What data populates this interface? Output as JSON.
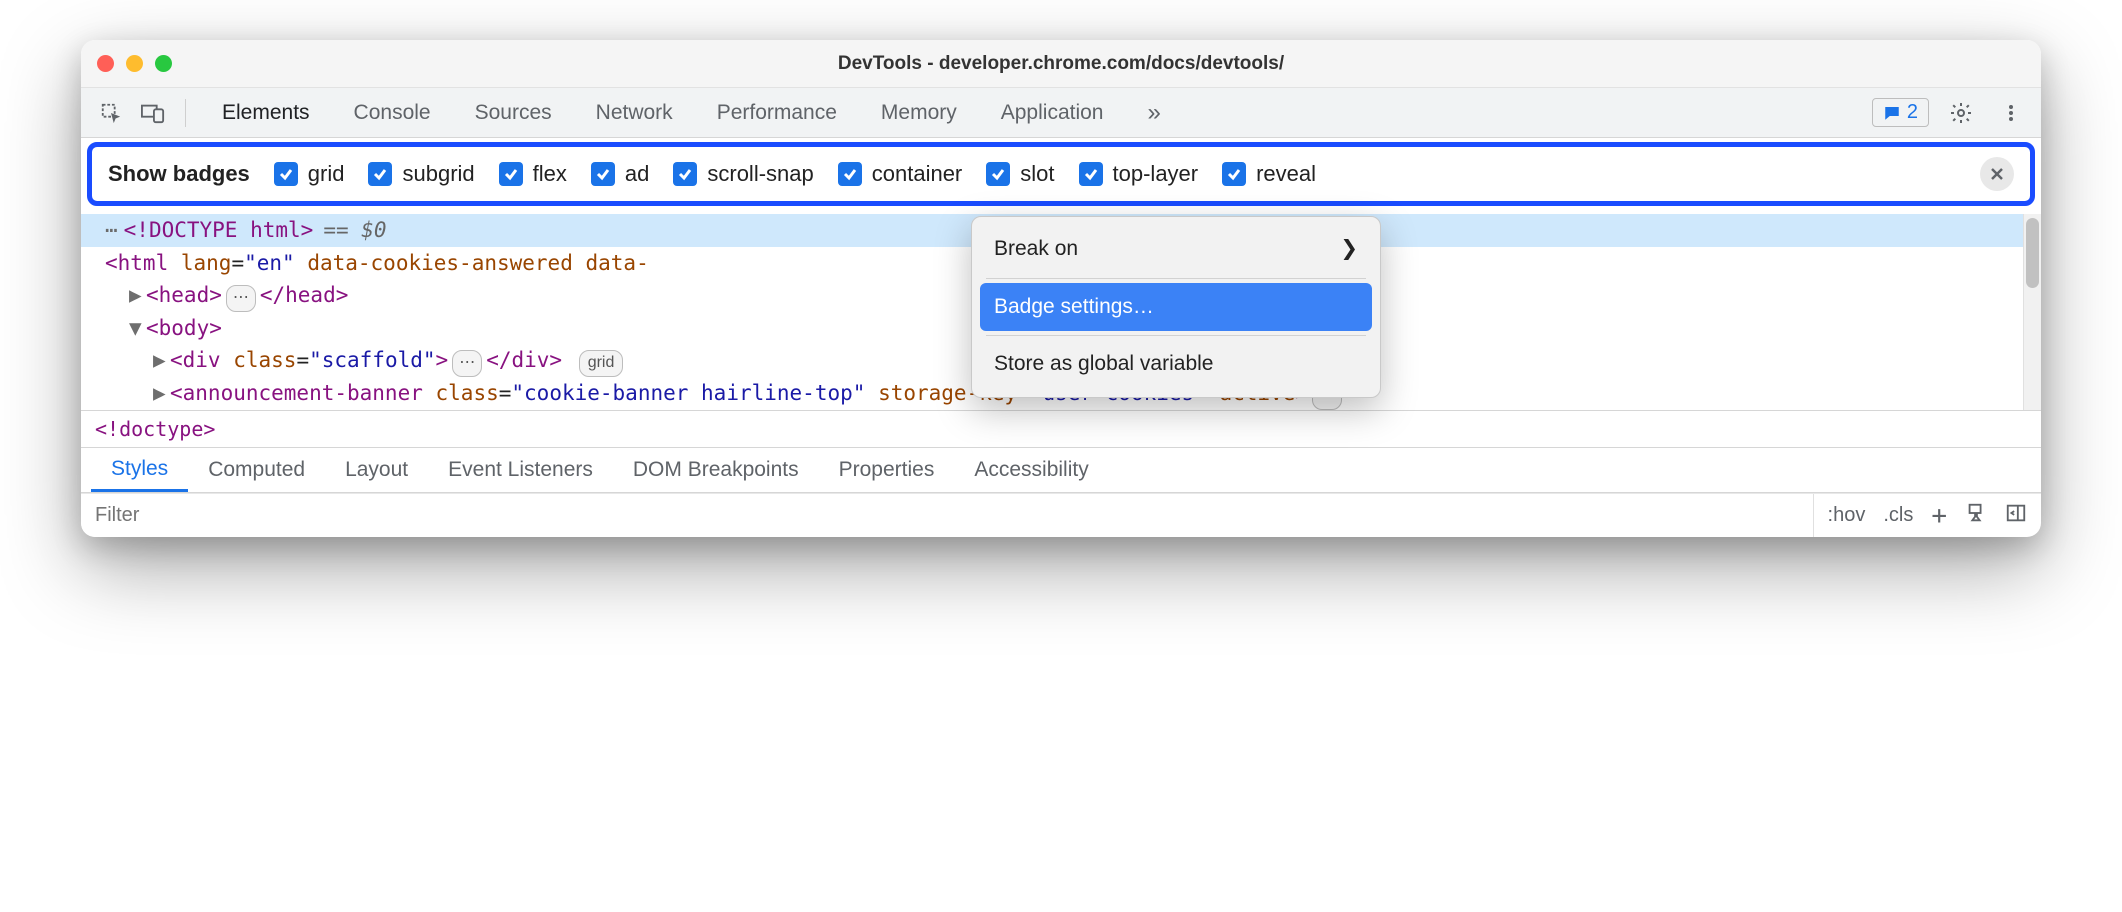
{
  "window": {
    "title": "DevTools - developer.chrome.com/docs/devtools/"
  },
  "toolbar": {
    "tabs": [
      "Elements",
      "Console",
      "Sources",
      "Network",
      "Performance",
      "Memory",
      "Application"
    ],
    "active_tab": "Elements",
    "overflow_symbol": "»",
    "issues_count": "2"
  },
  "badges_bar": {
    "label": "Show badges",
    "items": [
      "grid",
      "subgrid",
      "flex",
      "ad",
      "scroll-snap",
      "container",
      "slot",
      "top-layer",
      "reveal"
    ]
  },
  "dom": {
    "line1_text": "<!DOCTYPE html>",
    "line1_suffix": "== $0",
    "line2_prefix": "<html ",
    "line2_attr1_name": "lang",
    "line2_attr1_val": "\"en\"",
    "line2_attr2_name": "data-cookies-answered",
    "line2_attr3_name": "data-",
    "line3_open": "<head>",
    "line3_close": "</head>",
    "line4": "<body>",
    "line5_open": "<div ",
    "line5_attr_name": "class",
    "line5_attr_val": "\"scaffold\"",
    "line5_close_tag": "</div>",
    "line5_grid_badge": "grid",
    "line6_open": "<announcement-banner ",
    "line6_attr1_name": "class",
    "line6_attr1_val": "\"cookie-banner hairline-top\"",
    "line6_attr2_name": "storage-key",
    "line6_attr2_val": "\"user-cookies\"",
    "line6_attr3_name": "active",
    "ellipsis": "⋯"
  },
  "breadcrumb": {
    "text": "<!doctype>"
  },
  "styles_tabs": [
    "Styles",
    "Computed",
    "Layout",
    "Event Listeners",
    "DOM Breakpoints",
    "Properties",
    "Accessibility"
  ],
  "styles_active": "Styles",
  "filter": {
    "placeholder": "Filter",
    "hov": ":hov",
    "cls": ".cls"
  },
  "context_menu": {
    "items": [
      {
        "label": "Break on",
        "submenu": true,
        "highlight": false
      },
      {
        "label": "Badge settings…",
        "submenu": false,
        "highlight": true
      },
      {
        "label": "Store as global variable",
        "submenu": false,
        "highlight": false
      }
    ]
  }
}
